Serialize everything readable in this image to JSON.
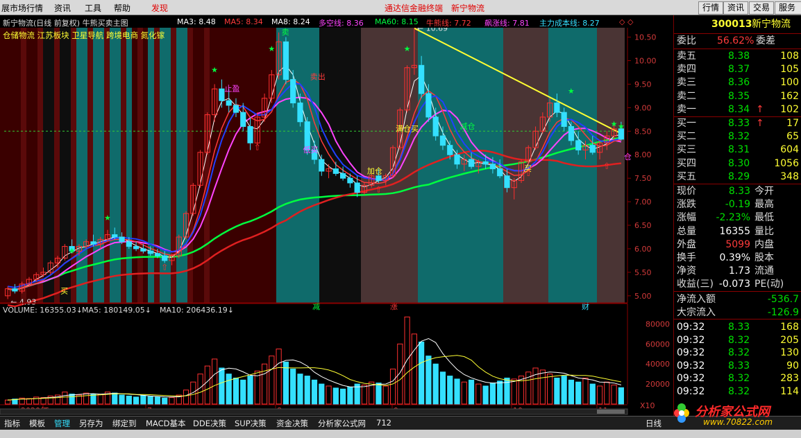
{
  "menu": {
    "items": [
      "展市场行情",
      "资讯",
      "工具",
      "帮助",
      "发现"
    ],
    "center_links": [
      "通达信金融终端",
      "新宁物流"
    ],
    "right_buttons": [
      "行情",
      "资讯",
      "交易",
      "服务"
    ]
  },
  "indicators": {
    "title": "新宁物流(日线 前复权) 牛熊买卖主图",
    "items": [
      {
        "label": "MA3: 8.48",
        "color": "#ffffff"
      },
      {
        "label": "MA5: 8.34",
        "color": "#ff3b3b"
      },
      {
        "label": "MA8: 8.24",
        "color": "#ffffff"
      },
      {
        "label": "多空线: 8.36",
        "color": "#ff44ff"
      },
      {
        "label": "MA60: 8.15",
        "color": "#00ff40"
      },
      {
        "label": "牛熊线: 7.72",
        "color": "#ff3b3b"
      },
      {
        "label": "飙涨线: 7.81",
        "color": "#ff44ff"
      },
      {
        "label": "主力成本线: 8.27",
        "color": "#34e0ff"
      }
    ],
    "sectors": "仓储物流 江苏板块 卫星导航 跨境电商 氮化镓"
  },
  "chart_data": {
    "type": "candlestick",
    "price_axis": {
      "ticks": [
        "10.50",
        "10.00",
        "9.50",
        "9.00",
        "8.50",
        "8.00",
        "7.50",
        "7.00",
        "6.50",
        "6.00",
        "5.50",
        "5.00"
      ],
      "range": [
        4.85,
        10.7
      ]
    },
    "annotations": {
      "high": "10.69",
      "low": "4.93"
    },
    "month_labels": [
      "2020年",
      "6",
      "7",
      "8",
      "9",
      "10",
      "11"
    ],
    "axis_markers": [
      "减",
      "涨",
      "财"
    ],
    "signal_labels": [
      "卖",
      "买",
      "低买",
      "加仓",
      "满仓买",
      "减仓",
      "止盈",
      "卖出",
      "仓",
      "买"
    ],
    "ohlc": [
      [
        5.0,
        5.2,
        4.93,
        5.15
      ],
      [
        5.15,
        5.25,
        5.05,
        5.1
      ],
      [
        5.1,
        5.3,
        5.05,
        5.25
      ],
      [
        5.25,
        5.4,
        5.2,
        5.35
      ],
      [
        5.35,
        5.5,
        5.3,
        5.45
      ],
      [
        5.45,
        5.6,
        5.4,
        5.5
      ],
      [
        5.5,
        5.75,
        5.45,
        5.7
      ],
      [
        5.7,
        5.85,
        5.6,
        5.8
      ],
      [
        5.8,
        6.1,
        5.75,
        6.05
      ],
      [
        6.05,
        6.2,
        5.9,
        5.95
      ],
      [
        5.95,
        6.1,
        5.85,
        6.05
      ],
      [
        6.05,
        6.2,
        6.0,
        6.15
      ],
      [
        6.15,
        6.3,
        6.05,
        6.1
      ],
      [
        6.1,
        6.25,
        6.0,
        6.2
      ],
      [
        6.2,
        6.4,
        6.15,
        6.3
      ],
      [
        6.3,
        6.45,
        6.2,
        6.25
      ],
      [
        6.25,
        6.35,
        6.1,
        6.15
      ],
      [
        6.15,
        6.25,
        6.0,
        6.05
      ],
      [
        6.05,
        6.15,
        5.95,
        6.0
      ],
      [
        6.0,
        6.1,
        5.9,
        5.95
      ],
      [
        5.95,
        6.05,
        5.85,
        5.9
      ],
      [
        5.9,
        6.0,
        5.8,
        5.85
      ],
      [
        5.85,
        5.95,
        5.7,
        5.75
      ],
      [
        5.75,
        5.9,
        5.65,
        5.85
      ],
      [
        5.85,
        6.3,
        5.8,
        6.25
      ],
      [
        6.25,
        6.8,
        6.2,
        6.75
      ],
      [
        6.75,
        7.4,
        6.7,
        7.35
      ],
      [
        7.35,
        8.1,
        7.3,
        8.05
      ],
      [
        8.05,
        8.9,
        8.0,
        8.85
      ],
      [
        8.85,
        9.5,
        8.7,
        9.4
      ],
      [
        9.4,
        9.6,
        9.0,
        9.15
      ],
      [
        9.15,
        9.4,
        8.9,
        9.05
      ],
      [
        9.05,
        9.2,
        8.8,
        8.9
      ],
      [
        8.9,
        9.1,
        8.5,
        8.6
      ],
      [
        8.6,
        8.8,
        8.1,
        8.25
      ],
      [
        8.25,
        8.9,
        8.2,
        8.8
      ],
      [
        8.8,
        9.3,
        8.7,
        9.2
      ],
      [
        9.2,
        9.8,
        9.1,
        9.7
      ],
      [
        9.7,
        10.6,
        9.6,
        10.4
      ],
      [
        10.4,
        10.5,
        9.5,
        9.6
      ],
      [
        9.6,
        9.8,
        9.0,
        9.1
      ],
      [
        9.1,
        9.3,
        8.6,
        8.7
      ],
      [
        8.7,
        8.8,
        8.0,
        8.1
      ],
      [
        8.1,
        8.3,
        7.8,
        7.9
      ],
      [
        7.9,
        8.0,
        7.55,
        7.65
      ],
      [
        7.65,
        7.8,
        7.5,
        7.7
      ],
      [
        7.7,
        7.85,
        7.55,
        7.6
      ],
      [
        7.6,
        7.75,
        7.45,
        7.5
      ],
      [
        7.5,
        7.6,
        7.3,
        7.4
      ],
      [
        7.4,
        7.55,
        7.1,
        7.2
      ],
      [
        7.2,
        7.4,
        7.15,
        7.35
      ],
      [
        7.35,
        7.6,
        7.3,
        7.55
      ],
      [
        7.55,
        7.7,
        7.4,
        7.45
      ],
      [
        7.45,
        7.6,
        7.35,
        7.55
      ],
      [
        7.55,
        8.2,
        7.5,
        8.15
      ],
      [
        8.15,
        9.0,
        8.1,
        8.95
      ],
      [
        8.95,
        9.9,
        8.9,
        9.85
      ],
      [
        9.85,
        10.69,
        9.7,
        9.9
      ],
      [
        9.9,
        10.1,
        9.2,
        9.3
      ],
      [
        9.3,
        9.5,
        8.7,
        8.8
      ],
      [
        8.8,
        9.0,
        8.3,
        8.4
      ],
      [
        8.4,
        8.6,
        8.1,
        8.2
      ],
      [
        8.2,
        8.3,
        7.9,
        8.0
      ],
      [
        8.0,
        8.1,
        7.7,
        7.8
      ],
      [
        7.8,
        8.0,
        7.65,
        7.9
      ],
      [
        7.9,
        8.05,
        7.7,
        7.75
      ],
      [
        7.75,
        7.9,
        7.6,
        7.85
      ],
      [
        7.85,
        8.0,
        7.7,
        7.8
      ],
      [
        7.8,
        7.95,
        7.6,
        7.7
      ],
      [
        7.7,
        7.9,
        7.5,
        7.55
      ],
      [
        7.55,
        7.7,
        7.2,
        7.3
      ],
      [
        7.3,
        7.5,
        7.05,
        7.45
      ],
      [
        7.45,
        7.9,
        7.4,
        7.85
      ],
      [
        7.85,
        8.2,
        7.8,
        8.15
      ],
      [
        8.15,
        8.6,
        8.1,
        8.5
      ],
      [
        8.5,
        8.9,
        8.45,
        8.8
      ],
      [
        8.8,
        9.2,
        8.7,
        9.1
      ],
      [
        9.1,
        9.3,
        8.8,
        8.9
      ],
      [
        8.9,
        9.0,
        8.5,
        8.6
      ],
      [
        8.6,
        8.7,
        8.2,
        8.3
      ],
      [
        8.3,
        8.5,
        8.0,
        8.1
      ],
      [
        8.1,
        8.3,
        7.9,
        8.2
      ],
      [
        8.2,
        8.4,
        8.0,
        8.05
      ],
      [
        8.05,
        8.3,
        7.9,
        8.25
      ],
      [
        8.25,
        8.5,
        8.1,
        8.4
      ],
      [
        8.4,
        8.7,
        8.3,
        8.55
      ],
      [
        8.55,
        8.7,
        8.3,
        8.33
      ]
    ],
    "volume": {
      "labels": {
        "volume": "VOLUME: 16355.03",
        "ma5": "MA5: 180149.05",
        "ma10": "MA10: 206436.19"
      },
      "ticks": [
        "80000",
        "60000",
        "40000",
        "20000"
      ],
      "unit": "X10",
      "range": [
        0,
        90000
      ],
      "values": [
        4000,
        5000,
        6000,
        5500,
        7000,
        6500,
        8000,
        9000,
        12000,
        10000,
        9000,
        11000,
        10000,
        9500,
        12000,
        11000,
        9000,
        8000,
        7000,
        8500,
        7500,
        7000,
        6000,
        6500,
        9000,
        14000,
        22000,
        30000,
        38000,
        45000,
        36000,
        30000,
        26000,
        24000,
        28000,
        33000,
        40000,
        48000,
        55000,
        42000,
        35000,
        30000,
        28000,
        24000,
        20000,
        18000,
        16000,
        15000,
        17000,
        20000,
        19000,
        22000,
        21000,
        18000,
        35000,
        60000,
        87000,
        70000,
        62000,
        48000,
        40000,
        32000,
        28000,
        25000,
        22000,
        24000,
        20000,
        18000,
        21000,
        23000,
        26000,
        25000,
        28000,
        32000,
        36000,
        34000,
        30000,
        26000,
        28000,
        24000,
        22000,
        26000,
        20000,
        18000,
        22000,
        19000,
        16355
      ]
    }
  },
  "quote": {
    "code": "300013",
    "name": "新宁物流",
    "weibi_label": "委比",
    "weibi_value": "56.62%",
    "weicha_label": "委差",
    "asks": [
      {
        "label": "卖五",
        "price": "8.38",
        "vol": "108"
      },
      {
        "label": "卖四",
        "price": "8.37",
        "vol": "105"
      },
      {
        "label": "卖三",
        "price": "8.36",
        "vol": "100"
      },
      {
        "label": "卖二",
        "price": "8.35",
        "vol": "162"
      },
      {
        "label": "卖一",
        "price": "8.34",
        "vol": "102",
        "arrow": "↑"
      }
    ],
    "bids": [
      {
        "label": "买一",
        "price": "8.33",
        "vol": "17",
        "arrow": "↑"
      },
      {
        "label": "买二",
        "price": "8.32",
        "vol": "65"
      },
      {
        "label": "买三",
        "price": "8.31",
        "vol": "604"
      },
      {
        "label": "买四",
        "price": "8.30",
        "vol": "1056"
      },
      {
        "label": "买五",
        "price": "8.29",
        "vol": "348"
      }
    ],
    "stats": [
      {
        "l1": "现价",
        "v1": "8.33",
        "c1": "green",
        "l2": "今开"
      },
      {
        "l1": "涨跌",
        "v1": "-0.19",
        "c1": "green",
        "l2": "最高"
      },
      {
        "l1": "涨幅",
        "v1": "-2.23%",
        "c1": "green",
        "l2": "最低"
      },
      {
        "l1": "总量",
        "v1": "16355",
        "c1": "white",
        "l2": "量比"
      },
      {
        "l1": "外盘",
        "v1": "5099",
        "c1": "red",
        "l2": "内盘"
      },
      {
        "l1": "换手",
        "v1": "0.39%",
        "c1": "white",
        "l2": "股本"
      },
      {
        "l1": "净资",
        "v1": "1.73",
        "c1": "white",
        "l2": "流通"
      },
      {
        "l1": "收益(三)",
        "v1": "-0.073",
        "c1": "white",
        "l2": "PE(动)"
      }
    ],
    "flows": [
      {
        "label": "净流入额",
        "value": "-536.7"
      },
      {
        "label": "大宗流入",
        "value": "-126.9"
      }
    ],
    "ticks": [
      {
        "time": "09:32",
        "price": "8.33",
        "vol": "168",
        "pc": "green"
      },
      {
        "time": "09:32",
        "price": "8.32",
        "vol": "205",
        "pc": "green"
      },
      {
        "time": "09:32",
        "price": "8.32",
        "vol": "130",
        "pc": "green"
      },
      {
        "time": "09:32",
        "price": "8.33",
        "vol": "90",
        "pc": "green"
      },
      {
        "time": "09:32",
        "price": "8.32",
        "vol": "283",
        "pc": "green"
      },
      {
        "time": "09:32",
        "price": "8.32",
        "vol": "114",
        "pc": "green"
      }
    ]
  },
  "tabs": [
    "指标",
    "模板",
    "管理",
    "另存为",
    "绑定到",
    "MACD基本",
    "DDE决策",
    "SUP决策",
    "资金决策",
    "分析家公式网",
    "712"
  ],
  "active_tab": "管理",
  "period_label": "日线",
  "watermark": {
    "text": "分析家公式网",
    "url": "www.70822.com"
  }
}
